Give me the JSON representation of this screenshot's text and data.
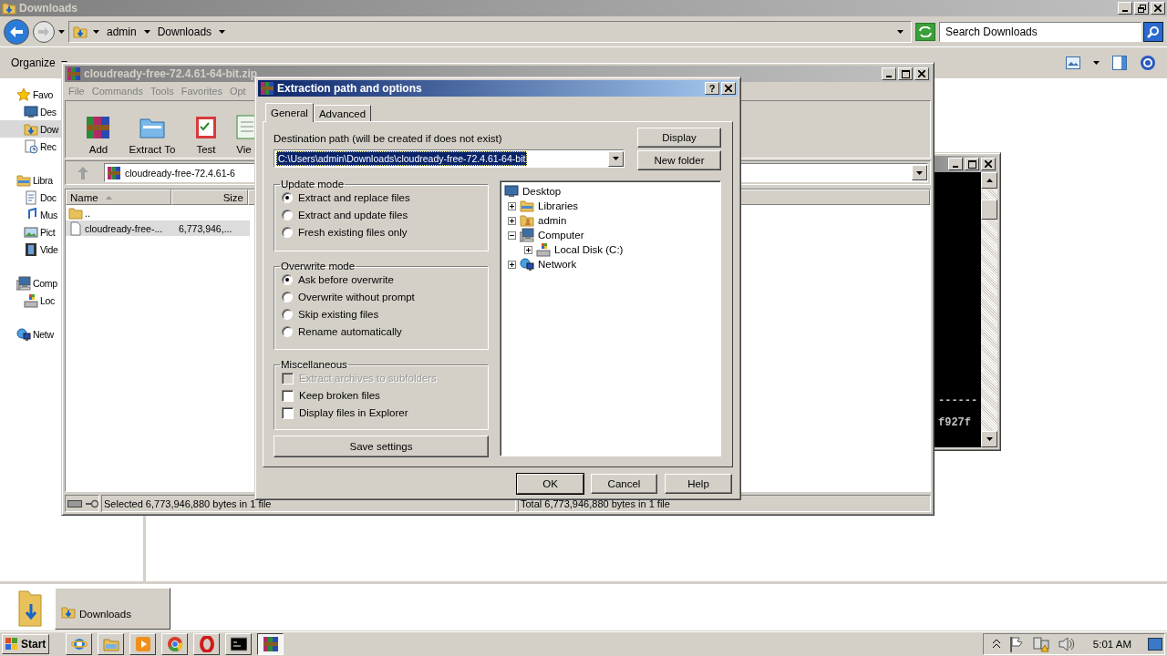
{
  "explorer": {
    "title": "Downloads",
    "active": false,
    "breadcrumb": [
      "admin",
      "Downloads"
    ],
    "search": {
      "placeholder": "Search Downloads"
    },
    "organize": "Organize",
    "nav": [
      {
        "label": "Favo",
        "kind": "star",
        "selected": false,
        "children": [
          {
            "label": "Des",
            "kind": "desktop",
            "selected": false
          },
          {
            "label": "Dow",
            "kind": "downloads",
            "selected": true
          },
          {
            "label": "Rec",
            "kind": "recent",
            "selected": false
          }
        ]
      },
      {
        "label": "Libra",
        "kind": "library",
        "selected": false,
        "children": [
          {
            "label": "Doc",
            "kind": "documents",
            "selected": false
          },
          {
            "label": "Mus",
            "kind": "music",
            "selected": false
          },
          {
            "label": "Pict",
            "kind": "pictures",
            "selected": false
          },
          {
            "label": "Vide",
            "kind": "videos",
            "selected": false
          }
        ]
      },
      {
        "label": "Comp",
        "kind": "computer",
        "selected": false,
        "children": [
          {
            "label": "Loc",
            "kind": "disk",
            "selected": false
          }
        ]
      },
      {
        "label": "Netw",
        "kind": "network",
        "selected": false
      }
    ]
  },
  "console": {
    "active": false,
    "lines": [
      "------",
      "f927f"
    ]
  },
  "winrar": {
    "title": "cloudready-free-72.4.61-64-bit.zip",
    "active": false,
    "menu": [
      "File",
      "Commands",
      "Tools",
      "Favorites",
      "Opt"
    ],
    "tools": [
      {
        "label": "Add",
        "kind": "add"
      },
      {
        "label": "Extract To",
        "kind": "extract"
      },
      {
        "label": "Test",
        "kind": "test"
      },
      {
        "label": "Vie",
        "kind": "view"
      }
    ],
    "path": "cloudready-free-72.4.61-6",
    "columns": [
      "Name",
      "Size"
    ],
    "rows": [
      {
        "name": "..",
        "kind": "folder_up",
        "selected": false
      },
      {
        "name": "cloudready-free-...",
        "size": "6,773,946,...",
        "kind": "file",
        "selected": true
      }
    ],
    "status_left": "Selected 6,773,946,880 bytes in 1 file",
    "status_right": "Total 6,773,946,880 bytes in 1 file"
  },
  "dialog": {
    "title": "Extraction path and options",
    "active": true,
    "help_button": "?",
    "tabs": [
      {
        "label": "General",
        "selected": true
      },
      {
        "label": "Advanced",
        "selected": false
      }
    ],
    "path_label": "Destination path (will be created if does not exist)",
    "path": "C:\\Users\\admin\\Downloads\\cloudready-free-72.4.61-64-bit",
    "path_text_selected": true,
    "side_buttons": [
      "Display",
      "New folder"
    ],
    "update_mode": {
      "title": "Update mode",
      "options": [
        {
          "label": "Extract and replace files",
          "selected": true
        },
        {
          "label": "Extract and update files",
          "selected": false
        },
        {
          "label": "Fresh existing files only",
          "selected": false
        }
      ]
    },
    "overwrite_mode": {
      "title": "Overwrite mode",
      "options": [
        {
          "label": "Ask before overwrite",
          "selected": true
        },
        {
          "label": "Overwrite without prompt",
          "selected": false
        },
        {
          "label": "Skip existing files",
          "selected": false
        },
        {
          "label": "Rename automatically",
          "selected": false
        }
      ]
    },
    "misc": {
      "title": "Miscellaneous",
      "options": [
        {
          "label": "Extract archives to subfolders",
          "checked": false,
          "disabled": true
        },
        {
          "label": "Keep broken files",
          "checked": false,
          "disabled": false
        },
        {
          "label": "Display files in Explorer",
          "checked": false,
          "disabled": false
        }
      ]
    },
    "save_button": "Save settings",
    "tree": [
      {
        "label": "Desktop",
        "kind": "desktop",
        "children": [
          {
            "label": "Libraries",
            "kind": "library",
            "expanded": false
          },
          {
            "label": "admin",
            "kind": "user",
            "expanded": false
          },
          {
            "label": "Computer",
            "kind": "computer",
            "expanded": true,
            "children": [
              {
                "label": "Local Disk (C:)",
                "kind": "disk",
                "expanded": false
              }
            ]
          },
          {
            "label": "Network",
            "kind": "network",
            "expanded": false
          }
        ]
      }
    ],
    "buttons": [
      "OK",
      "Cancel",
      "Help"
    ]
  },
  "preview": {
    "label": "Downloads"
  },
  "taskbar": {
    "start": "Start",
    "apps": [
      {
        "kind": "ie",
        "selected": false
      },
      {
        "kind": "explorer",
        "selected": false
      },
      {
        "kind": "media",
        "selected": false
      },
      {
        "kind": "chrome",
        "selected": false
      },
      {
        "kind": "opera",
        "selected": false
      },
      {
        "kind": "cmd",
        "selected": false
      },
      {
        "kind": "winrar",
        "selected": true
      }
    ],
    "clock": "5:01 AM"
  }
}
